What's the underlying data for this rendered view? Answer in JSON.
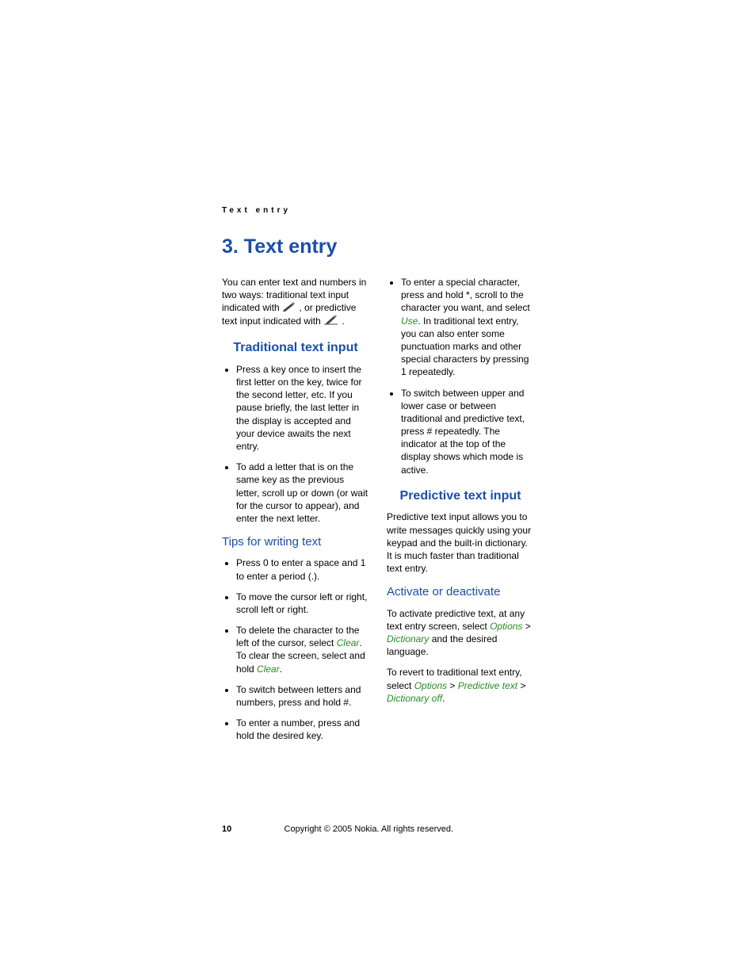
{
  "running_header": "Text entry",
  "chapter_title": "3.  Text entry",
  "intro": {
    "p1a": "You can enter text and numbers in two ways: traditional text input indicated with ",
    "p1b": " , or predictive text input indicated with ",
    "p1c": " ."
  },
  "traditional": {
    "heading": "Traditional text input",
    "b1": "Press a key once to insert the first letter on the key, twice for the second letter, etc. If you pause briefly, the last letter in the display is accepted and your device awaits the next entry.",
    "b2": "To add a letter that is on the same key as the previous letter, scroll up or down (or wait for the cursor to appear), and enter the next letter."
  },
  "tips": {
    "heading": "Tips for writing text",
    "b1": "Press 0 to enter a space and 1 to enter a period (.).",
    "b2": "To move the cursor left or right, scroll left or right.",
    "b3a": "To delete the character to the left of the cursor, select ",
    "b3_clear": "Clear",
    "b3b": ". To clear the screen, select and hold ",
    "b3c": ".",
    "b4": "To switch between letters and numbers, press and hold #.",
    "b5": "To enter a number, press and hold the desired key.",
    "b6a": "To enter a special character, press and hold *, scroll to the character you want, and select ",
    "b6_use": "Use",
    "b6b": ". In traditional text entry, you can also enter some punctuation marks and other special characters by pressing 1 repeatedly.",
    "b7": "To switch between upper and lower case or between traditional and predictive text, press # repeatedly. The indicator at the top of the display shows which mode is active."
  },
  "predictive": {
    "heading": "Predictive text input",
    "p1": "Predictive text input allows you to write messages quickly using your keypad and the built-in dictionary. It is much faster than traditional text entry."
  },
  "activate": {
    "heading": "Activate or deactivate",
    "p1a": "To activate predictive text, at any text entry screen, select ",
    "options": "Options",
    "gt": " > ",
    "dictionary": "Dictionary",
    "p1b": " and the desired language.",
    "p2a": "To revert to traditional text entry, select ",
    "predictive_text": "Predictive text",
    "dictionary_off": "Dictionary off",
    "period": "."
  },
  "footer": {
    "page": "10",
    "copyright": "Copyright © 2005 Nokia. All rights reserved."
  }
}
